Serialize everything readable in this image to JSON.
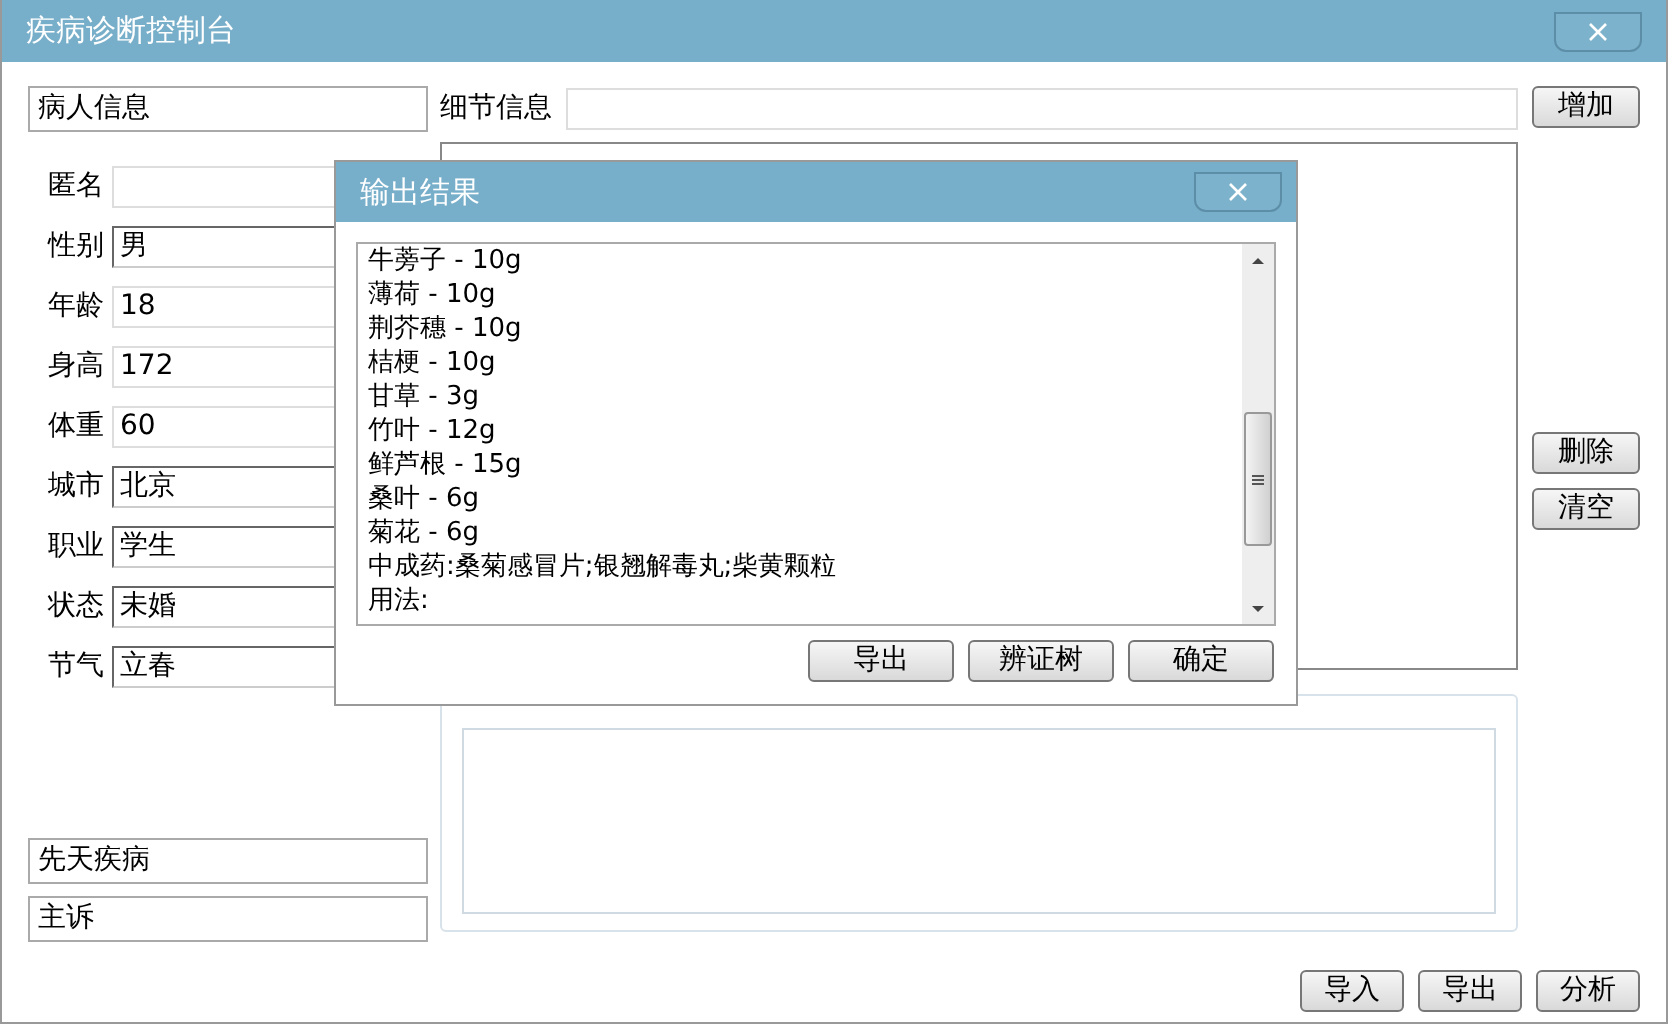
{
  "window": {
    "title": "疾病诊断控制台"
  },
  "patient_panel": {
    "heading": "病人信息",
    "fields": [
      {
        "label": "匿名",
        "kind": "text"
      },
      {
        "label": "性别",
        "value": "男",
        "kind": "combo"
      },
      {
        "label": "年龄",
        "value": "18",
        "kind": "text"
      },
      {
        "label": "身高",
        "value": "172",
        "kind": "text"
      },
      {
        "label": "体重",
        "value": "60",
        "kind": "text"
      },
      {
        "label": "城市",
        "value": "北京",
        "kind": "combo"
      },
      {
        "label": "职业",
        "value": "学生",
        "kind": "combo"
      },
      {
        "label": "状态",
        "value": "未婚",
        "kind": "combo"
      },
      {
        "label": "节气",
        "value": "立春",
        "kind": "combo"
      }
    ],
    "sections": [
      "先天疾病",
      "主诉"
    ]
  },
  "detail": {
    "label": "细节信息",
    "add_button": "增加",
    "side_buttons": [
      "删除",
      "清空"
    ]
  },
  "bottom_buttons": [
    "导入",
    "导出",
    "分析"
  ],
  "dialog": {
    "title": "输出结果",
    "lines": [
      "牛蒡子 - 10g",
      "薄荷 - 10g",
      "荆芥穗 - 10g",
      "桔梗 - 10g",
      "甘草 - 3g",
      "竹叶 - 12g",
      "鲜芦根 - 15g",
      "桑叶 - 6g",
      "菊花 - 6g",
      "中成药:桑菊感冒片;银翘解毒丸;柴黄颗粒",
      "用法:"
    ],
    "buttons": [
      "导出",
      "辨证树",
      "确定"
    ]
  }
}
